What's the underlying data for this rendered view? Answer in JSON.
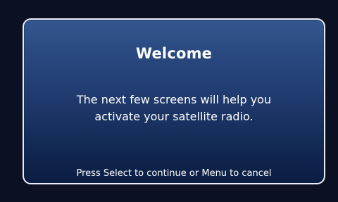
{
  "dialog": {
    "title": "Welcome",
    "message_lines": [
      "The next few screens will help you",
      "activate your satellite radio."
    ],
    "instruction": "Press Select to continue or Menu to cancel"
  },
  "colors": {
    "screen_background": "#0b1022",
    "dialog_gradient_top": "#35578f",
    "dialog_gradient_bottom": "#0b1d42",
    "dialog_border": "#e9edf6",
    "text": "#ffffff"
  }
}
